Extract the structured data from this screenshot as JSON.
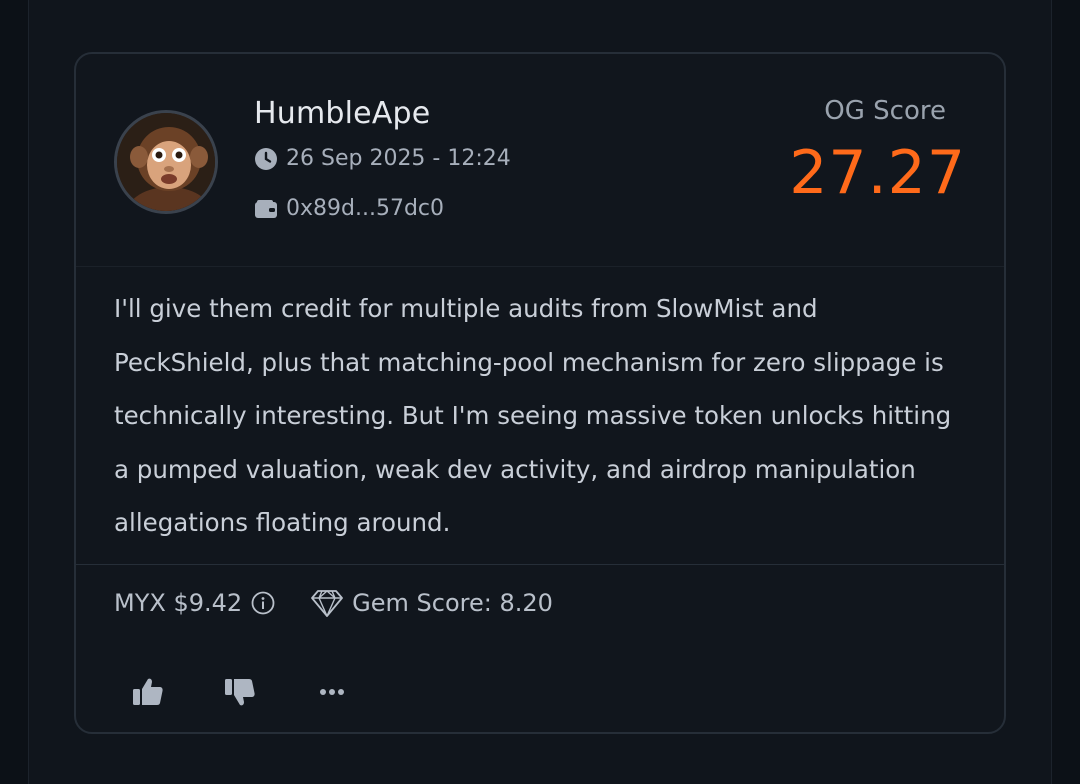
{
  "post": {
    "username": "HumbleApe",
    "timestamp": "26 Sep 2025 - 12:24",
    "wallet": "0x89d...57dc0",
    "og_score_label": "OG Score",
    "og_score_value": "27.27",
    "body": "I'll give them credit for multiple audits from SlowMist and PeckShield, plus that matching-pool mechanism for zero slippage is technically interesting. But I'm seeing massive token unlocks hitting a pumped valuation, weak dev activity, and airdrop manipulation allegations floating around.",
    "token_price": "MYX $9.42",
    "gem_score": "Gem Score: 8.20"
  },
  "icons": {
    "time": "clock-icon",
    "wallet": "wallet-icon",
    "info": "info-icon",
    "gem": "diamond-icon",
    "like": "thumbs-up-icon",
    "dislike": "thumbs-down-icon",
    "more": "ellipsis-icon"
  },
  "colors": {
    "og_score": "#ff6a1a",
    "card_bg": "#11161d",
    "page_bg": "#0c1117",
    "border": "#262e38"
  }
}
